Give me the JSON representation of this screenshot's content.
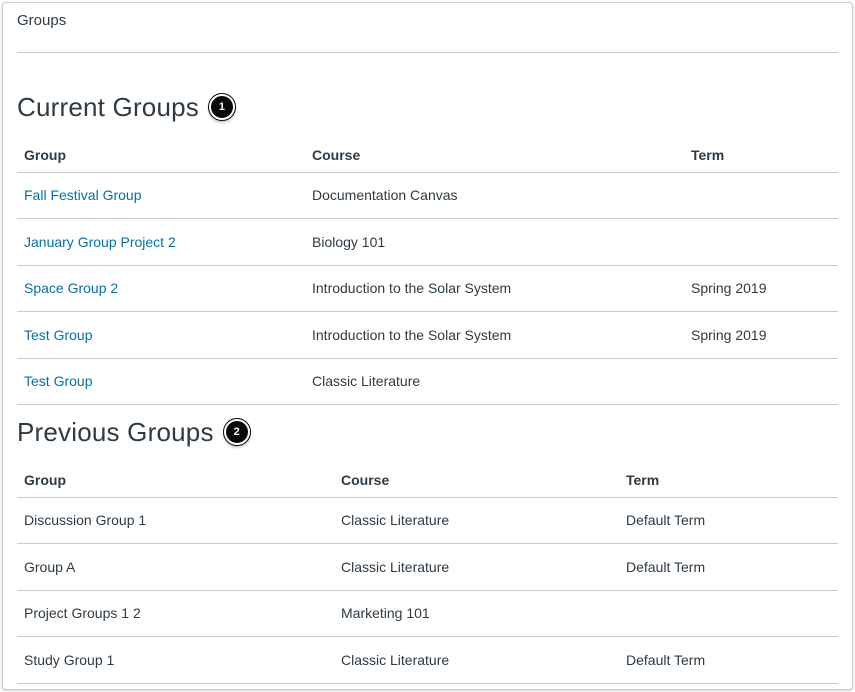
{
  "header": {
    "title": "Groups"
  },
  "current_groups": {
    "title": "Current Groups",
    "callout": "1",
    "columns": [
      "Group",
      "Course",
      "Term"
    ],
    "rows": [
      {
        "group": "Fall Festival Group",
        "course": "Documentation Canvas",
        "term": ""
      },
      {
        "group": "January Group Project 2",
        "course": "Biology 101",
        "term": ""
      },
      {
        "group": "Space Group 2",
        "course": "Introduction to the Solar System",
        "term": "Spring 2019"
      },
      {
        "group": "Test Group",
        "course": "Introduction to the Solar System",
        "term": "Spring 2019"
      },
      {
        "group": "Test Group",
        "course": "Classic Literature",
        "term": ""
      }
    ]
  },
  "previous_groups": {
    "title": "Previous Groups",
    "callout": "2",
    "columns": [
      "Group",
      "Course",
      "Term"
    ],
    "rows": [
      {
        "group": "Discussion Group 1",
        "course": "Classic Literature",
        "term": "Default Term"
      },
      {
        "group": "Group A",
        "course": "Classic Literature",
        "term": "Default Term"
      },
      {
        "group": "Project Groups 1 2",
        "course": "Marketing 101",
        "term": ""
      },
      {
        "group": "Study Group 1",
        "course": "Classic Literature",
        "term": "Default Term"
      }
    ]
  },
  "colors": {
    "link": "#0770a3",
    "text": "#2d3b45",
    "divider": "#c7cdd1",
    "callout_bg": "#0a0a0a"
  }
}
